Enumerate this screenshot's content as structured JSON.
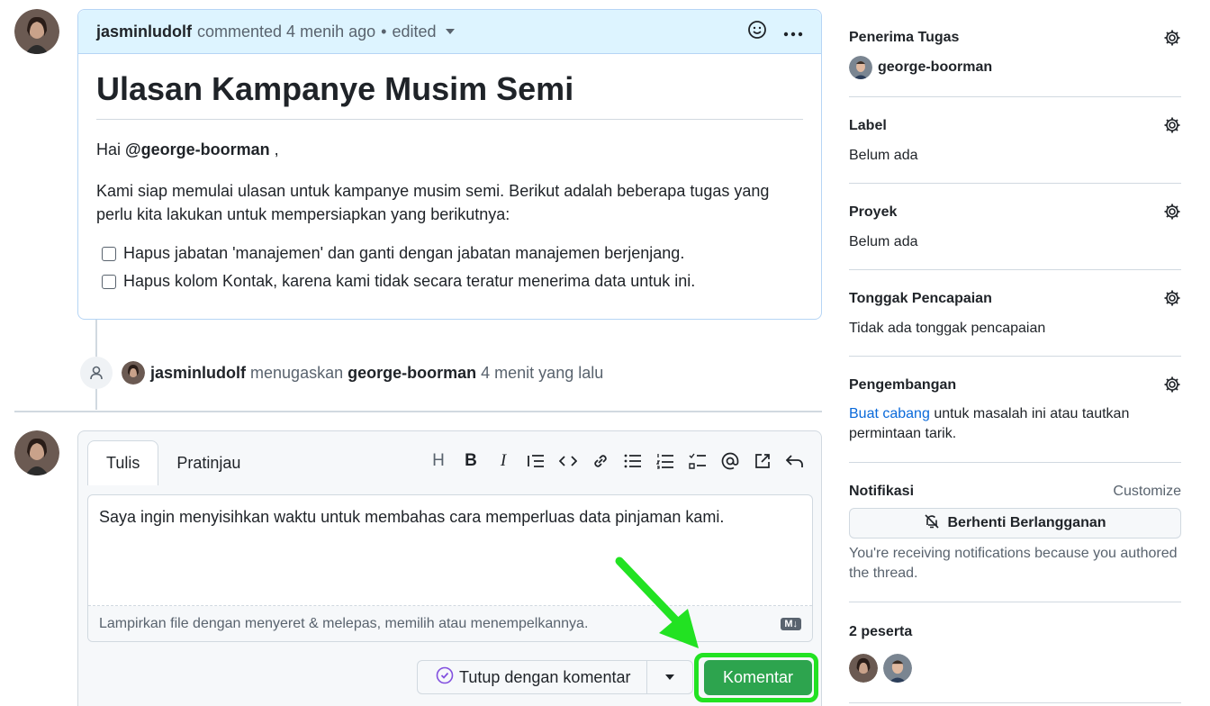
{
  "comment": {
    "author": "jasminludolf",
    "meta": "commented 4 menih ago",
    "edited": "edited",
    "title": "Ulasan Kampanye Musim Semi",
    "greeting_prefix": "Hai",
    "greeting_mention": "@george-boorman",
    "greeting_suffix": ",",
    "body": "Kami siap memulai ulasan untuk kampanye musim semi. Berikut adalah beberapa tugas yang perlu kita lakukan untuk mempersiapkan yang berikutnya:",
    "tasks": [
      "Hapus jabatan 'manajemen' dan ganti dengan jabatan manajemen berjenjang.",
      "Hapus kolom Kontak, karena kami tidak secara teratur menerima data untuk ini."
    ]
  },
  "timeline": {
    "actor": "jasminludolf",
    "action": "menugaskan",
    "target": "george-boorman",
    "time": "4 menit yang lalu"
  },
  "composer": {
    "tab_write": "Tulis",
    "tab_preview": "Pratinjau",
    "toolbar_heading": "H",
    "toolbar_bold": "B",
    "toolbar_italic": "I",
    "text": "Saya ingin menyisihkan waktu untuk membahas cara memperluas data pinjaman kami.",
    "attach_hint": "Lampirkan file dengan menyeret & melepas, memilih atau menempelkannya.",
    "md_badge": "M↓",
    "close_label": "Tutup dengan komentar",
    "submit_label": "Komentar"
  },
  "sidebar": {
    "assignees_title": "Penerima Tugas",
    "assignee": "george-boorman",
    "labels_title": "Label",
    "labels_value": "Belum ada",
    "projects_title": "Proyek",
    "projects_value": "Belum ada",
    "milestone_title": "Tonggak Pencapaian",
    "milestone_value": "Tidak ada tonggak pencapaian",
    "development_title": "Pengembangan",
    "development_link": "Buat cabang",
    "development_text": "untuk masalah ini atau tautkan permintaan tarik.",
    "notifications_title": "Notifikasi",
    "customize": "Customize",
    "unsubscribe": "Berhenti Berlangganan",
    "notice": "You're receiving notifications because you authored the thread.",
    "participants": "2 peserta"
  },
  "colors": {
    "accent": "#0969da",
    "submit": "#2da44e",
    "highlight": "#22e222",
    "comment_header": "#ddf4ff"
  }
}
